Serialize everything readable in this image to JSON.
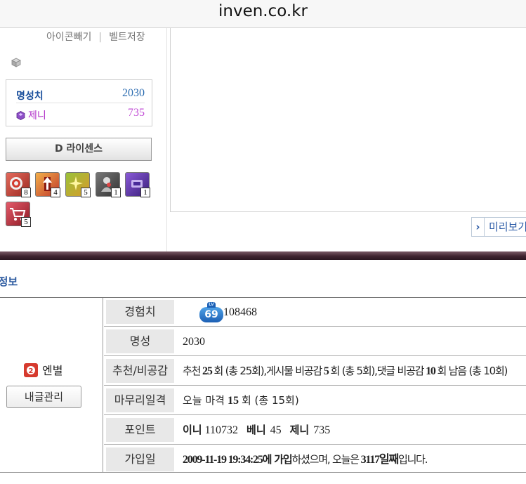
{
  "browser": {
    "url": "inven.co.kr"
  },
  "sidebar": {
    "links": {
      "icon_pull": "아이콘빼기",
      "belt_save": "벨트저장",
      "separator": "|"
    },
    "stats": {
      "fame_label": "명성치",
      "fame_value": "2030",
      "zeni_label": "제니",
      "zeni_value": "735"
    },
    "license_button": "D 라이센스",
    "items": [
      {
        "icon": "target-item-icon",
        "count": "8",
        "color": "#c8413a"
      },
      {
        "icon": "arrow-up-item-icon",
        "count": "4",
        "color": "#d4542a"
      },
      {
        "icon": "sparkle-item-icon",
        "count": "5",
        "color": "#9aa22a"
      },
      {
        "icon": "figure-item-icon",
        "count": "1",
        "color": "#555555"
      },
      {
        "icon": "purple-item-icon",
        "count": "1",
        "color": "#6a3fb0"
      },
      {
        "icon": "cart-item-icon",
        "count": "5",
        "color": "#c0303a"
      }
    ]
  },
  "preview_button": "미리보기",
  "section": {
    "title": "활동정보"
  },
  "profile": {
    "nickname": "엔별",
    "my_posts_button": "내글관리"
  },
  "info_rows": {
    "exp": {
      "label": "경험치",
      "level": "69",
      "level_tag": "LV",
      "value": "108468"
    },
    "fame": {
      "label": "명성",
      "value": "2030"
    },
    "votes": {
      "label": "추천/비공감",
      "recommend_pre": "추천",
      "recommend_count": "25",
      "recommend_post": "회 (총 25회),",
      "post_dislike_pre": "게시물 비공감",
      "post_dislike_count": "5",
      "post_dislike_post": "회 (총 5회),",
      "comment_dislike_pre": "댓글 비공감",
      "comment_dislike_count": "10",
      "comment_dislike_post": "회 남음 (총 10회)"
    },
    "finish": {
      "label": "마무리일격",
      "pre": "오늘 마격",
      "count": "15",
      "post": "회 (총 15회)"
    },
    "points": {
      "label": "포인트",
      "ini_label": "이니",
      "ini_value": "110732",
      "beni_label": "베니",
      "beni_value": "45",
      "zeni_label": "제니",
      "zeni_value": "735"
    },
    "joined": {
      "label": "가입일",
      "date": "2009-11-19 19:34:25",
      "date_suffix": "에 가입",
      "mid": "하셨으며, 오늘은",
      "days": "3117일째",
      "end": "입니다."
    }
  }
}
